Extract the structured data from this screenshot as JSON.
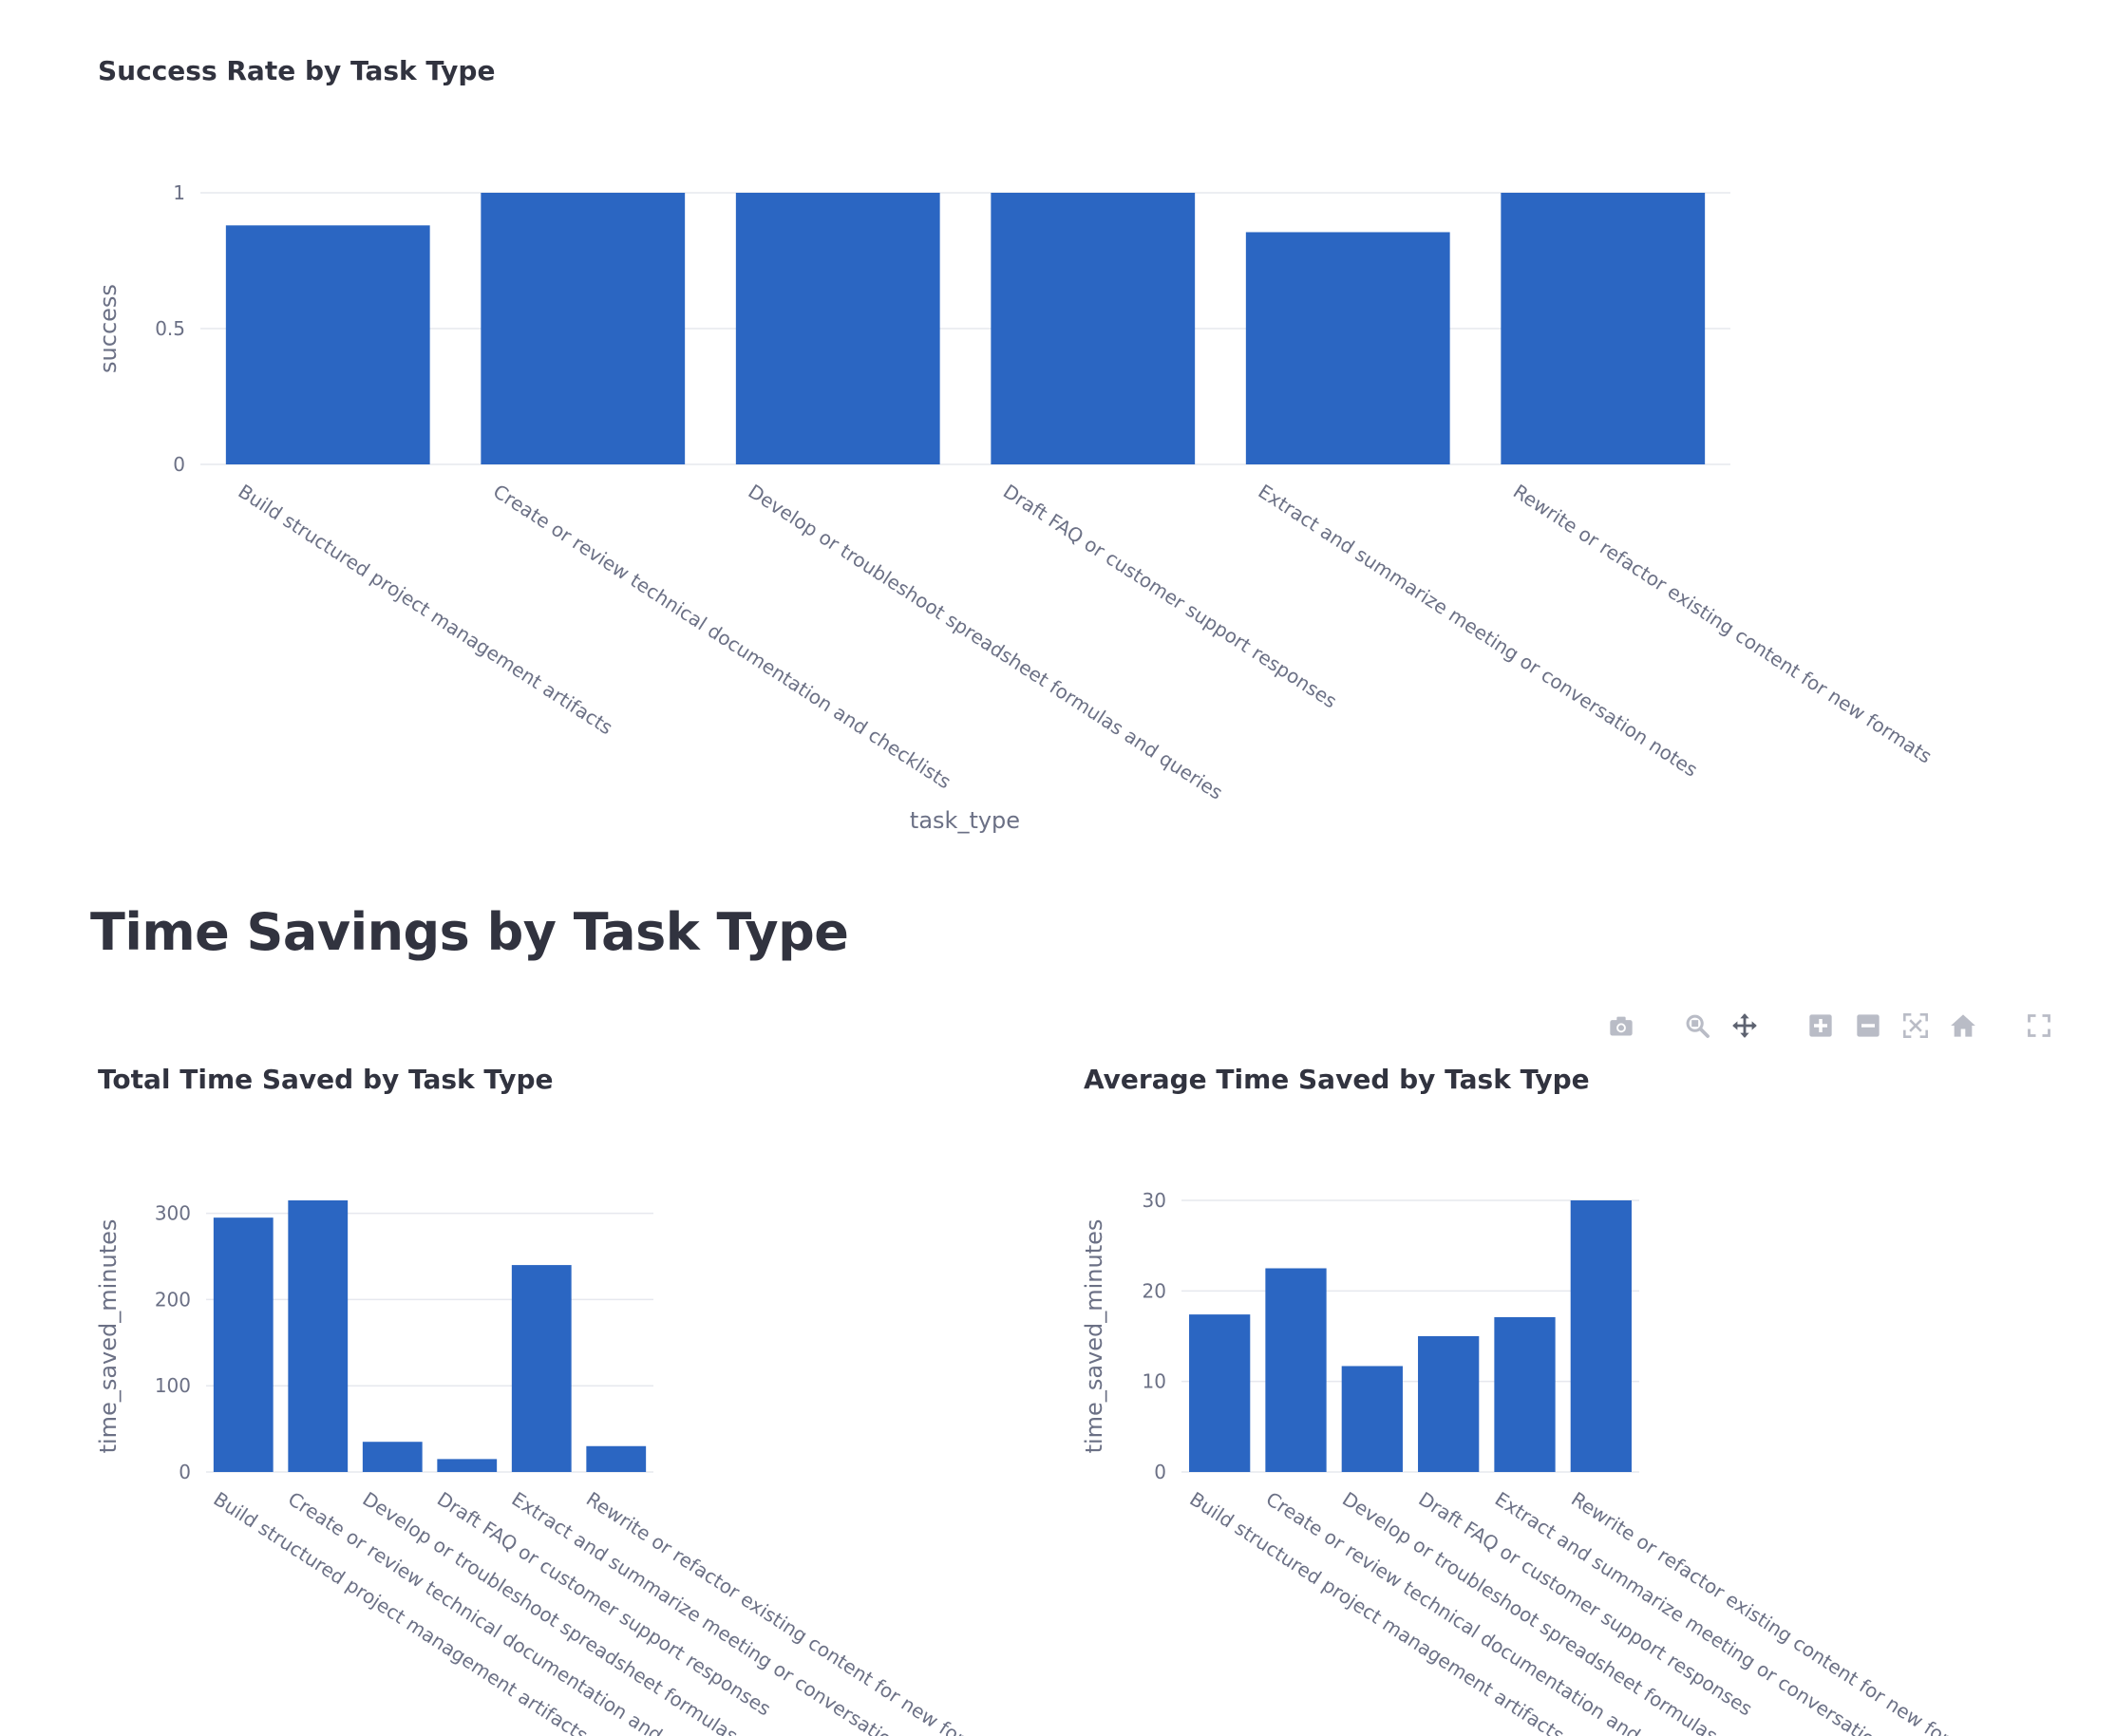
{
  "sections": {
    "time_savings_heading": "Time Savings by Task Type"
  },
  "modebar": {
    "buttons": [
      {
        "name": "camera-icon",
        "label": "Download plot as a png"
      },
      {
        "name": "zoom-icon",
        "label": "Zoom"
      },
      {
        "name": "pan-icon",
        "label": "Pan"
      },
      {
        "name": "zoom-in-icon",
        "label": "Zoom in"
      },
      {
        "name": "zoom-out-icon",
        "label": "Zoom out"
      },
      {
        "name": "autoscale-icon",
        "label": "Autoscale"
      },
      {
        "name": "home-icon",
        "label": "Reset axes"
      },
      {
        "name": "fullscreen-icon",
        "label": "View fullscreen"
      }
    ]
  },
  "colors": {
    "bar": "#2b66c2",
    "grid": "#e6e8ee",
    "axis_text": "#6b7085",
    "title_text": "#31333f"
  },
  "chart_data": [
    {
      "id": "success",
      "type": "bar",
      "title": "Success Rate by Task Type",
      "xlabel": "task_type",
      "ylabel": "success",
      "categories": [
        "Build structured project management artifacts",
        "Create or review technical documentation and checklists",
        "Develop or troubleshoot spreadsheet formulas and queries",
        "Draft FAQ or customer support responses",
        "Extract and summarize meeting or conversation notes",
        "Rewrite or refactor existing content for new formats"
      ],
      "values": [
        0.88,
        1.0,
        1.0,
        1.0,
        0.855,
        1.0
      ],
      "ylim": [
        0,
        1
      ],
      "yticks": [
        0,
        0.5,
        1
      ],
      "ytick_labels": [
        "0",
        "0.5",
        "1"
      ],
      "grid": true
    },
    {
      "id": "total_time",
      "type": "bar",
      "title": "Total Time Saved by Task Type",
      "xlabel": "",
      "ylabel": "time_saved_minutes",
      "categories": [
        "Build structured project management artifacts",
        "Create or review technical documentation and checklists",
        "Develop or troubleshoot spreadsheet formulas and queries",
        "Draft FAQ or customer support responses",
        "Extract and summarize meeting or conversation notes",
        "Rewrite or refactor existing content for new formats"
      ],
      "values": [
        295,
        315,
        35,
        15,
        240,
        30
      ],
      "ylim": [
        0,
        315
      ],
      "yticks": [
        0,
        100,
        200,
        300
      ],
      "ytick_labels": [
        "0",
        "100",
        "200",
        "300"
      ],
      "grid": true
    },
    {
      "id": "avg_time",
      "type": "bar",
      "title": "Average Time Saved by Task Type",
      "xlabel": "",
      "ylabel": "time_saved_minutes",
      "categories": [
        "Build structured project management artifacts",
        "Create or review technical documentation and checklists",
        "Develop or troubleshoot spreadsheet formulas and queries",
        "Draft FAQ or customer support responses",
        "Extract and summarize meeting or conversation notes",
        "Rewrite or refactor existing content for new formats"
      ],
      "values": [
        17.4,
        22.5,
        11.7,
        15,
        17.1,
        30
      ],
      "ylim": [
        0,
        30
      ],
      "yticks": [
        0,
        10,
        20,
        30
      ],
      "ytick_labels": [
        "0",
        "10",
        "20",
        "30"
      ],
      "grid": true
    }
  ]
}
